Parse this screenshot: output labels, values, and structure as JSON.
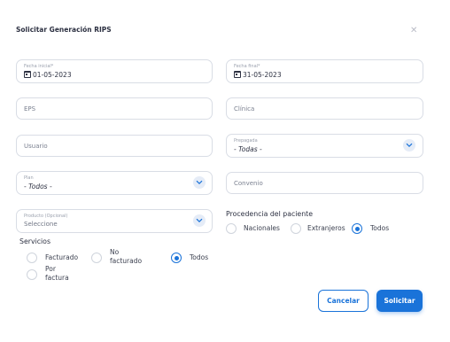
{
  "dialog": {
    "title": "Solicitar Generación RIPS",
    "close_icon": "close-icon"
  },
  "fields": {
    "fecha_inicial": {
      "label": "Fecha inicial*",
      "value": "01-05-2023",
      "icon": "calendar-icon"
    },
    "fecha_final": {
      "label": "Fecha final*",
      "value": "31-05-2023",
      "icon": "calendar-icon"
    },
    "eps": {
      "placeholder": "EPS"
    },
    "clinica": {
      "placeholder": "Clínica"
    },
    "usuario": {
      "placeholder": "Usuario"
    },
    "prepagada": {
      "label": "Prepagada",
      "value": "- Todas -"
    },
    "plan": {
      "label": "Plan",
      "value": "- Todos -"
    },
    "convenio": {
      "placeholder": "Convenio"
    },
    "producto": {
      "label": "Producto (Opcional)",
      "value": "Seleccione"
    }
  },
  "procedencia": {
    "title": "Procedencia del paciente",
    "options": [
      {
        "label": "Nacionales",
        "checked": false
      },
      {
        "label": "Extranjeros",
        "checked": false
      },
      {
        "label": "Todos",
        "checked": true
      }
    ]
  },
  "servicios": {
    "title": "Servicios",
    "options": [
      {
        "label": "Facturado",
        "checked": false
      },
      {
        "label_line1": "No",
        "label_line2": "facturado",
        "checked": false
      },
      {
        "label": "Todos",
        "checked": true
      },
      {
        "label_line1": "Por",
        "label_line2": "factura",
        "checked": false
      }
    ]
  },
  "buttons": {
    "cancel": "Cancelar",
    "submit": "Solicitar"
  },
  "colors": {
    "accent": "#1a73d9",
    "border": "#d9dde5",
    "chevron_bg": "#e5ecf7"
  }
}
